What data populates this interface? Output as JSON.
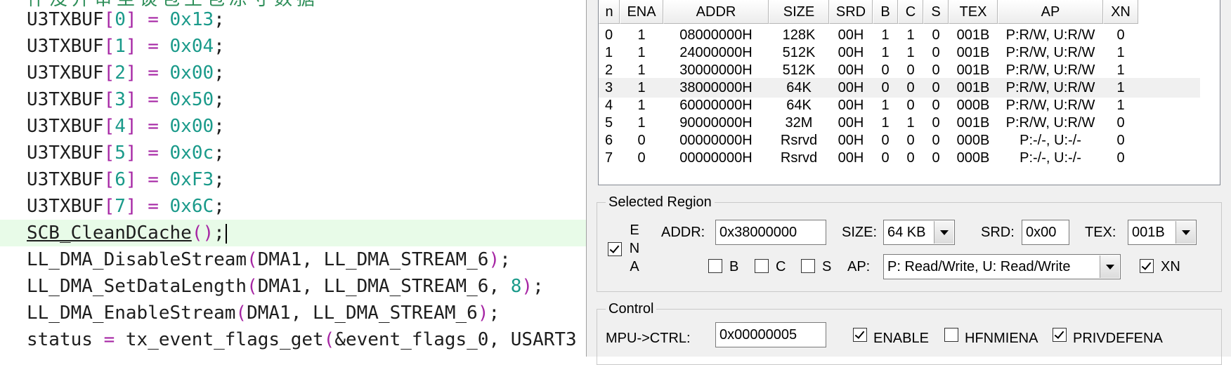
{
  "editor": {
    "clipped_top": "什没开审至谈包王包凉寸数据",
    "lines": [
      {
        "var": "U3TXBUF",
        "idx": "0",
        "val": "0x13"
      },
      {
        "var": "U3TXBUF",
        "idx": "1",
        "val": "0x04"
      },
      {
        "var": "U3TXBUF",
        "idx": "2",
        "val": "0x00"
      },
      {
        "var": "U3TXBUF",
        "idx": "3",
        "val": "0x50"
      },
      {
        "var": "U3TXBUF",
        "idx": "4",
        "val": "0x00"
      },
      {
        "var": "U3TXBUF",
        "idx": "5",
        "val": "0x0c"
      },
      {
        "var": "U3TXBUF",
        "idx": "6",
        "val": "0xF3"
      },
      {
        "var": "U3TXBUF",
        "idx": "7",
        "val": "0x6C"
      }
    ],
    "clean_call": "SCB_CleanDCache",
    "dma_disable": {
      "fn": "LL_DMA_DisableStream",
      "args": "DMA1, LL_DMA_STREAM_6"
    },
    "dma_setlen": {
      "fn": "LL_DMA_SetDataLength",
      "args": "DMA1, LL_DMA_STREAM_6, ",
      "num": "8"
    },
    "dma_enable": {
      "fn": "LL_DMA_EnableStream",
      "args": "DMA1, LL_DMA_STREAM_6"
    },
    "status_line": {
      "lhs": "status",
      "fn": "tx_event_flags_get",
      "args": "&event_flags_0, USART3"
    }
  },
  "mpu_table": {
    "columns": [
      "n",
      "ENA",
      "ADDR",
      "SIZE",
      "SRD",
      "B",
      "C",
      "S",
      "TEX",
      "AP",
      "XN"
    ],
    "rows": [
      [
        "0",
        "1",
        "08000000H",
        "128K",
        "00H",
        "1",
        "1",
        "0",
        "001B",
        "P:R/W, U:R/W",
        "0"
      ],
      [
        "1",
        "1",
        "24000000H",
        "512K",
        "00H",
        "1",
        "1",
        "0",
        "001B",
        "P:R/W, U:R/W",
        "1"
      ],
      [
        "2",
        "1",
        "30000000H",
        "512K",
        "00H",
        "0",
        "0",
        "0",
        "001B",
        "P:R/W, U:R/W",
        "1"
      ],
      [
        "3",
        "1",
        "38000000H",
        "64K",
        "00H",
        "0",
        "0",
        "0",
        "001B",
        "P:R/W, U:R/W",
        "1"
      ],
      [
        "4",
        "1",
        "60000000H",
        "64K",
        "00H",
        "1",
        "0",
        "0",
        "000B",
        "P:R/W, U:R/W",
        "1"
      ],
      [
        "5",
        "1",
        "90000000H",
        "32M",
        "00H",
        "1",
        "1",
        "0",
        "001B",
        "P:R/W, U:R/W",
        "0"
      ],
      [
        "6",
        "0",
        "00000000H",
        "Rsrvd",
        "00H",
        "0",
        "0",
        "0",
        "000B",
        "P:-/-, U:-/-",
        "0"
      ],
      [
        "7",
        "0",
        "00000000H",
        "Rsrvd",
        "00H",
        "0",
        "0",
        "0",
        "000B",
        "P:-/-, U:-/-",
        "0"
      ]
    ],
    "selected_row": 3
  },
  "selected_region": {
    "title": "Selected Region",
    "ena_checked": true,
    "ena_letters": [
      "E",
      "N",
      "A"
    ],
    "addr_label": "ADDR:",
    "addr_value": "0x38000000",
    "size_label": "SIZE:",
    "size_value": "64 KB",
    "srd_label": "SRD:",
    "srd_value": "0x00",
    "tex_label": "TEX:",
    "tex_value": "001B",
    "b_label": "B",
    "b_checked": false,
    "c_label": "C",
    "c_checked": false,
    "s_label": "S",
    "s_checked": false,
    "ap_label": "AP:",
    "ap_value": "P: Read/Write, U: Read/Write",
    "xn_label": "XN",
    "xn_checked": true
  },
  "control": {
    "title": "Control",
    "ctrl_label": "MPU->CTRL:",
    "ctrl_value": "0x00000005",
    "enable_label": "ENABLE",
    "enable_checked": true,
    "hfnmiena_label": "HFNMIENA",
    "hfnmiena_checked": false,
    "privdefena_label": "PRIVDEFENA",
    "privdefena_checked": true
  }
}
